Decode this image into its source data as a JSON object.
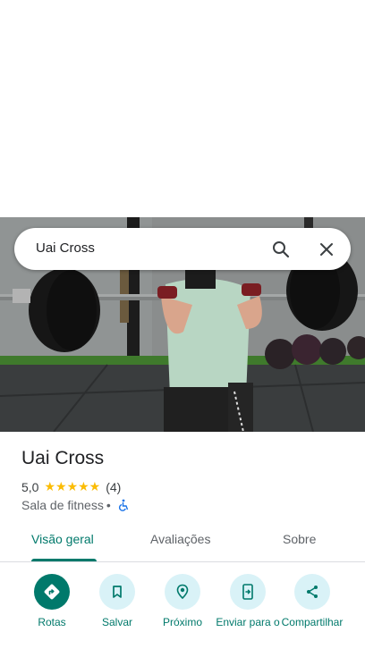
{
  "search": {
    "query": "Uai Cross"
  },
  "place": {
    "name": "Uai Cross",
    "rating": "5,0",
    "stars": "★★★★★",
    "review_count": "(4)",
    "category": "Sala de fitness",
    "separator": "•"
  },
  "tabs": [
    {
      "label": "Visão geral",
      "active": true
    },
    {
      "label": "Avaliações",
      "active": false
    },
    {
      "label": "Sobre",
      "active": false
    }
  ],
  "actions": [
    {
      "label": "Rotas"
    },
    {
      "label": "Salvar"
    },
    {
      "label": "Próximo"
    },
    {
      "label": "Enviar para o"
    },
    {
      "label": "Compartilhar"
    }
  ],
  "colors": {
    "accent": "#00796b",
    "chip_bg": "#d9f2f7",
    "star": "#fbbc04"
  }
}
